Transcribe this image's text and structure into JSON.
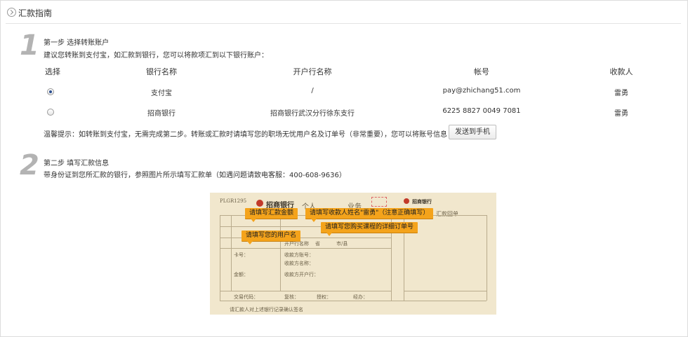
{
  "header": {
    "title": "汇款指南"
  },
  "step1": {
    "number": "1",
    "title": "第一步 选择转账账户",
    "desc": "建议您转账到支付宝，如汇款到银行，您可以将款项汇到以下银行账户："
  },
  "table": {
    "headers": [
      "选择",
      "银行名称",
      "开户行名称",
      "帐号",
      "收款人"
    ],
    "rows": [
      {
        "selected": true,
        "bank": "支付宝",
        "branch": "/",
        "account": "pay@zhichang51.com",
        "payee": "雷勇"
      },
      {
        "selected": false,
        "bank": "招商银行",
        "branch": "招商银行武汉分行徐东支行",
        "account": "6225 8827 0049 7081",
        "payee": "雷勇"
      }
    ]
  },
  "tip": {
    "text": "温馨提示：如转账到支付宝，无需完成第二步。转账或汇款时请填写您的职场无忧用户名及订单号（非常重要），您可以将账号信息",
    "button_label": "发送到手机"
  },
  "step2": {
    "number": "2",
    "title": "第二步 填写汇款信息",
    "desc": "带身份证到您所汇款的银行，参照图片所示填写汇款单（如遇问题请致电客服：400-608-9636）"
  },
  "slip": {
    "code": "PLGR1295",
    "bank_name": "招商银行",
    "bank_name_right": "招商银行",
    "form_title": "汇款回单",
    "callouts": {
      "amount": "请填写汇款金额",
      "payee": "请填写收款人姓名\"雷勇\"（注意正确填写）",
      "order": "请填写您购买课程的详细订单号",
      "username": "请填写您的用户名"
    },
    "labels": {
      "personal": "个人",
      "business": "业务",
      "branch": "开户行名称",
      "province": "省",
      "city": "市/县",
      "card": "卡号：",
      "account_no": "收款方账号：",
      "account_name": "收款方名称：",
      "payee_bank": "收款方开户行：",
      "amount": "金额：",
      "trade_code": "交易代码：",
      "review": "复核：",
      "authorize": "授权：",
      "handle": "经办：",
      "footer": "请汇款人对上述银行记录确认签名"
    }
  }
}
